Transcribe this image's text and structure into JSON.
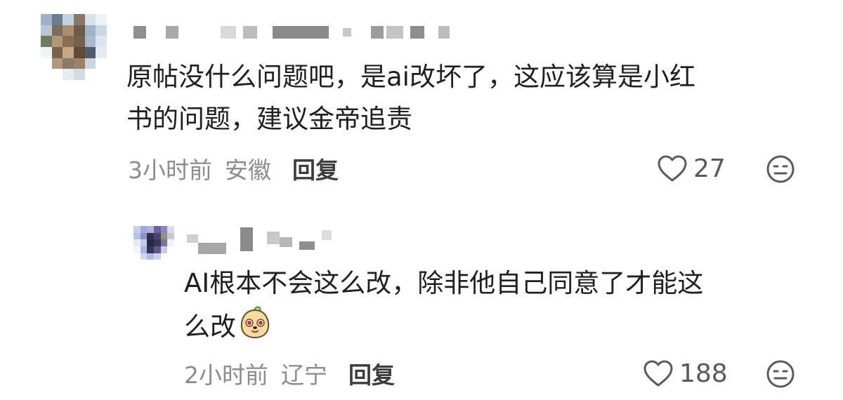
{
  "comments": [
    {
      "text": "原帖没什么问题吧，是ai改坏了，这应该算是小红\n书的问题，建议金帝追责",
      "time": "3小时前",
      "location": "安徽",
      "reply_label": "回复",
      "likes": "27"
    }
  ],
  "reply": {
    "text_line1": "AI根本不会这么改，除非他自己同意了才能这",
    "text_line2": "么改",
    "emoji_icon": "dog-face-sticker-icon",
    "time": "2小时前",
    "location": "辽宁",
    "reply_label": "回复",
    "likes": "188"
  },
  "colors": {
    "text_primary": "#1f1f1f",
    "text_secondary": "#8c8c8c",
    "reply_label": "#3d3d3d",
    "like_count": "#5a5a5a"
  }
}
